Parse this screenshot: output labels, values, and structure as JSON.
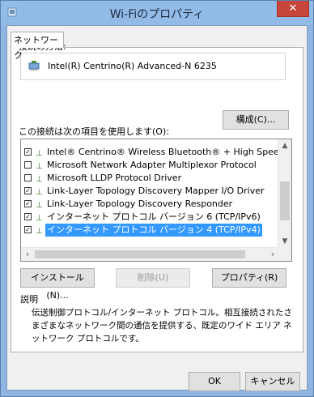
{
  "window": {
    "title": "Wi-Fiのプロパティ",
    "close_glyph": "✕"
  },
  "tabs": [
    {
      "label": "ネットワーク"
    }
  ],
  "connection": {
    "label": "接続の方法:",
    "adapter": "Intel(R) Centrino(R) Advanced-N 6235",
    "configure_button": "構成(C)..."
  },
  "items_label": "この接続は次の項目を使用します(O):",
  "items": [
    {
      "checked": true,
      "label": "Intel® Centrino® Wireless Bluetooth® + High Speed フ"
    },
    {
      "checked": false,
      "label": "Microsoft Network Adapter Multiplexor Protocol"
    },
    {
      "checked": false,
      "label": "Microsoft LLDP Protocol Driver"
    },
    {
      "checked": true,
      "label": "Link-Layer Topology Discovery Mapper I/O Driver"
    },
    {
      "checked": true,
      "label": "Link-Layer Topology Discovery Responder"
    },
    {
      "checked": true,
      "label": "インターネット プロトコル バージョン 6 (TCP/IPv6)"
    },
    {
      "checked": true,
      "label": "インターネット プロトコル バージョン 4 (TCP/IPv4)",
      "selected": true
    }
  ],
  "actions": {
    "install": "インストール(N)...",
    "uninstall": "削除(U)",
    "properties": "プロパティ(R)"
  },
  "description": {
    "label": "説明",
    "text": "伝送制御プロトコル/インターネット プロトコル。相互接続されたさまざまなネットワーク間の通信を提供する、既定のワイド エリア ネットワーク プロトコルです。"
  },
  "footer": {
    "ok": "OK",
    "cancel": "キャンセル"
  },
  "colors": {
    "titlebar": "#93bbe8",
    "close": "#c7463b",
    "selection": "#3399ff"
  }
}
